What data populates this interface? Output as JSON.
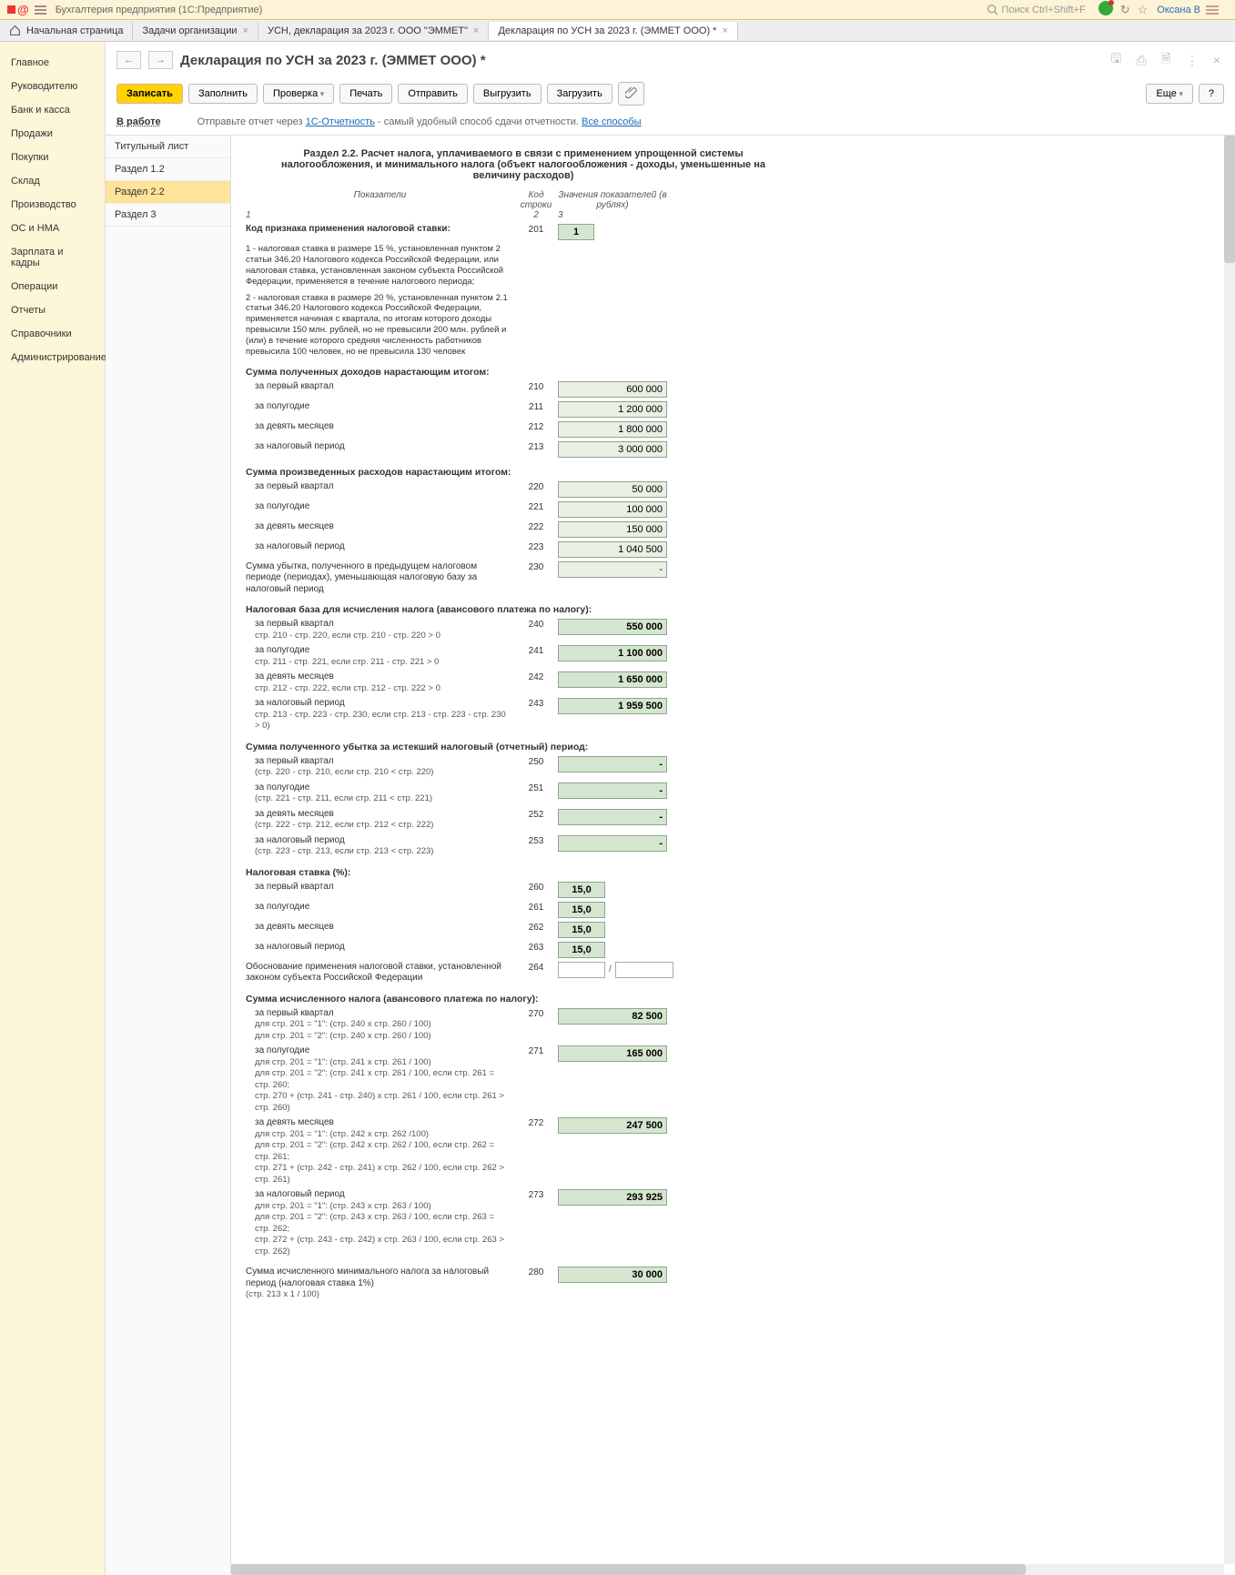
{
  "app": {
    "title": "Бухгалтерия предприятия  (1С:Предприятие)",
    "search_placeholder": "Поиск Ctrl+Shift+F",
    "user": "Оксана В"
  },
  "tabs": {
    "home": "Начальная страница",
    "t1": "Задачи организации",
    "t2": "УСН, декларация за 2023 г. ООО \"ЭММЕТ\"",
    "t3": "Декларация по УСН за 2023 г. (ЭММЕТ ООО) *"
  },
  "sidebar": {
    "items": [
      "Главное",
      "Руководителю",
      "Банк и касса",
      "Продажи",
      "Покупки",
      "Склад",
      "Производство",
      "ОС и НМА",
      "Зарплата и кадры",
      "Операции",
      "Отчеты",
      "Справочники",
      "Администрирование"
    ]
  },
  "page": {
    "title": "Декларация по УСН за 2023 г. (ЭММЕТ ООО) *"
  },
  "toolbar": {
    "zapisat": "Записать",
    "zapolnit": "Заполнить",
    "proverka": "Проверка",
    "pechat": "Печать",
    "otpravit": "Отправить",
    "vygruzit": "Выгрузить",
    "zagruzit": "Загрузить",
    "esche": "Еще",
    "help": "?"
  },
  "status": {
    "link": "В работе",
    "prefix": "Отправьте отчет через ",
    "a1": "1С-Отчетность",
    "mid": " - самый удобный способ сдачи отчетности. ",
    "a2": "Все способы"
  },
  "sections": {
    "s1": "Титульный лист",
    "s2": "Раздел 1.2",
    "s3": "Раздел 2.2",
    "s4": "Раздел 3"
  },
  "form": {
    "title": "Раздел 2.2. Расчет налога, уплачиваемого в связи с применением упрощенной системы налогообложения, и минимального налога (объект налогообложения - доходы, уменьшенные на величину расходов)",
    "colh": {
      "c1": "Показатели",
      "c2": "Код строки",
      "c3": "Значения показателей (в рублях)",
      "n1": "1",
      "n2": "2",
      "n3": "3"
    },
    "r201": {
      "label": "Код признака применения налоговой ставки:",
      "code": "201",
      "val": "1",
      "note1": "1 - налоговая ставка в размере 15 %, установленная пунктом 2 статьи 346.20 Налогового кодекса Российской Федерации, или налоговая ставка, установленная законом субъекта Российской Федерации, применяется в течение налогового периода;",
      "note2": "2 - налоговая ставка в размере 20 %, установленная пунктом 2.1 статьи 346.20 Налогового кодекса Российской Федерации, применяется начиная с квартала, по итогам которого доходы превысили 150 млн. рублей, но не превысили 200 млн. рублей и (или) в течение которого средняя численность работников превысила 100 человек, но не превысила 130 человек"
    },
    "g_income": "Сумма полученных доходов нарастающим итогом:",
    "r210": {
      "label": "за первый квартал",
      "code": "210",
      "val": "600 000"
    },
    "r211": {
      "label": "за полугодие",
      "code": "211",
      "val": "1 200 000"
    },
    "r212": {
      "label": "за девять месяцев",
      "code": "212",
      "val": "1 800 000"
    },
    "r213": {
      "label": "за налоговый период",
      "code": "213",
      "val": "3 000 000"
    },
    "g_expense": "Сумма произведенных расходов нарастающим итогом:",
    "r220": {
      "label": "за первый квартал",
      "code": "220",
      "val": "50 000"
    },
    "r221": {
      "label": "за полугодие",
      "code": "221",
      "val": "100 000"
    },
    "r222": {
      "label": "за девять месяцев",
      "code": "222",
      "val": "150 000"
    },
    "r223": {
      "label": "за налоговый период",
      "code": "223",
      "val": "1 040 500"
    },
    "r230": {
      "label": "Сумма убытка, полученного в предыдущем налоговом периоде (периодах), уменьшающая налоговую базу за налоговый период",
      "code": "230",
      "val": "-"
    },
    "g_base": "Налоговая база для исчисления налога (авансового платежа по налогу):",
    "r240": {
      "label": "за первый квартал",
      "sub": "стр. 210 - стр. 220, если стр. 210 - стр. 220 > 0",
      "code": "240",
      "val": "550 000"
    },
    "r241": {
      "label": "за полугодие",
      "sub": "стр. 211 - стр. 221, если стр. 211 - стр. 221 > 0",
      "code": "241",
      "val": "1 100 000"
    },
    "r242": {
      "label": "за девять месяцев",
      "sub": "стр. 212 - стр. 222, если стр. 212 - стр. 222 > 0",
      "code": "242",
      "val": "1 650 000"
    },
    "r243": {
      "label": "за налоговый период",
      "sub": "стр. 213 - стр. 223 - стр. 230, если стр. 213 - стр. 223 - стр. 230 > 0)",
      "code": "243",
      "val": "1 959 500"
    },
    "g_loss": "Сумма полученного убытка за истекший налоговый (отчетный) период:",
    "r250": {
      "label": "за первый квартал",
      "sub": "(стр. 220 - стр. 210, если стр. 210 < стр. 220)",
      "code": "250",
      "val": "-"
    },
    "r251": {
      "label": "за полугодие",
      "sub": "(стр. 221 - стр. 211, если стр. 211 < стр. 221)",
      "code": "251",
      "val": "-"
    },
    "r252": {
      "label": "за девять месяцев",
      "sub": "(стр. 222 - стр. 212, если стр. 212 < стр. 222)",
      "code": "252",
      "val": "-"
    },
    "r253": {
      "label": "за налоговый период",
      "sub": "(стр. 223 - стр. 213, если стр. 213 < стр. 223)",
      "code": "253",
      "val": "-"
    },
    "g_rate": "Налоговая ставка (%):",
    "r260": {
      "label": "за первый квартал",
      "code": "260",
      "val": "15,0"
    },
    "r261": {
      "label": "за полугодие",
      "code": "261",
      "val": "15,0"
    },
    "r262": {
      "label": "за девять месяцев",
      "code": "262",
      "val": "15,0"
    },
    "r263": {
      "label": "за налоговый период",
      "code": "263",
      "val": "15,0"
    },
    "r264": {
      "label": "Обоснование применения налоговой ставки, установленной законом субъекта Российской Федерации",
      "code": "264"
    },
    "g_tax": "Сумма исчисленного налога (авансового платежа по налогу):",
    "r270": {
      "label": "за первый квартал",
      "sub": "для стр. 201 = \"1\": (стр. 240 x стр. 260 / 100)\nдля стр. 201 = \"2\": (стр. 240 x стр. 260 / 100)",
      "code": "270",
      "val": "82 500"
    },
    "r271": {
      "label": "за полугодие",
      "sub": "для стр. 201 = \"1\": (стр. 241 x стр. 261 / 100)\nдля стр. 201 = \"2\": (стр. 241 x стр. 261 / 100, если стр. 261 = стр. 260;\nстр. 270 + (стр. 241 - стр. 240) x стр. 261 / 100, если стр. 261 > стр. 260)",
      "code": "271",
      "val": "165 000"
    },
    "r272": {
      "label": "за девять месяцев",
      "sub": "для стр. 201 = \"1\": (стр. 242 x стр. 262 /100)\nдля стр. 201 = \"2\": (стр. 242 x стр. 262 / 100, если стр. 262 = стр. 261;\nстр. 271 + (стр. 242 - стр. 241) x стр. 262 / 100, если стр. 262 > стр. 261)",
      "code": "272",
      "val": "247 500"
    },
    "r273": {
      "label": "за налоговый период",
      "sub": "для стр. 201 = \"1\": (стр. 243 x стр. 263 / 100)\nдля стр. 201 = \"2\": (стр. 243 x стр. 263 / 100, если стр. 263 = стр. 262;\nстр. 272 + (стр. 243 - стр. 242) x стр. 263 / 100, если стр. 263 > стр. 262)",
      "code": "273",
      "val": "293 925"
    },
    "r280": {
      "label": "Сумма исчисленного минимального налога за налоговый период (налоговая ставка 1%)",
      "sub": "(стр. 213 x 1 / 100)",
      "code": "280",
      "val": "30 000"
    }
  }
}
